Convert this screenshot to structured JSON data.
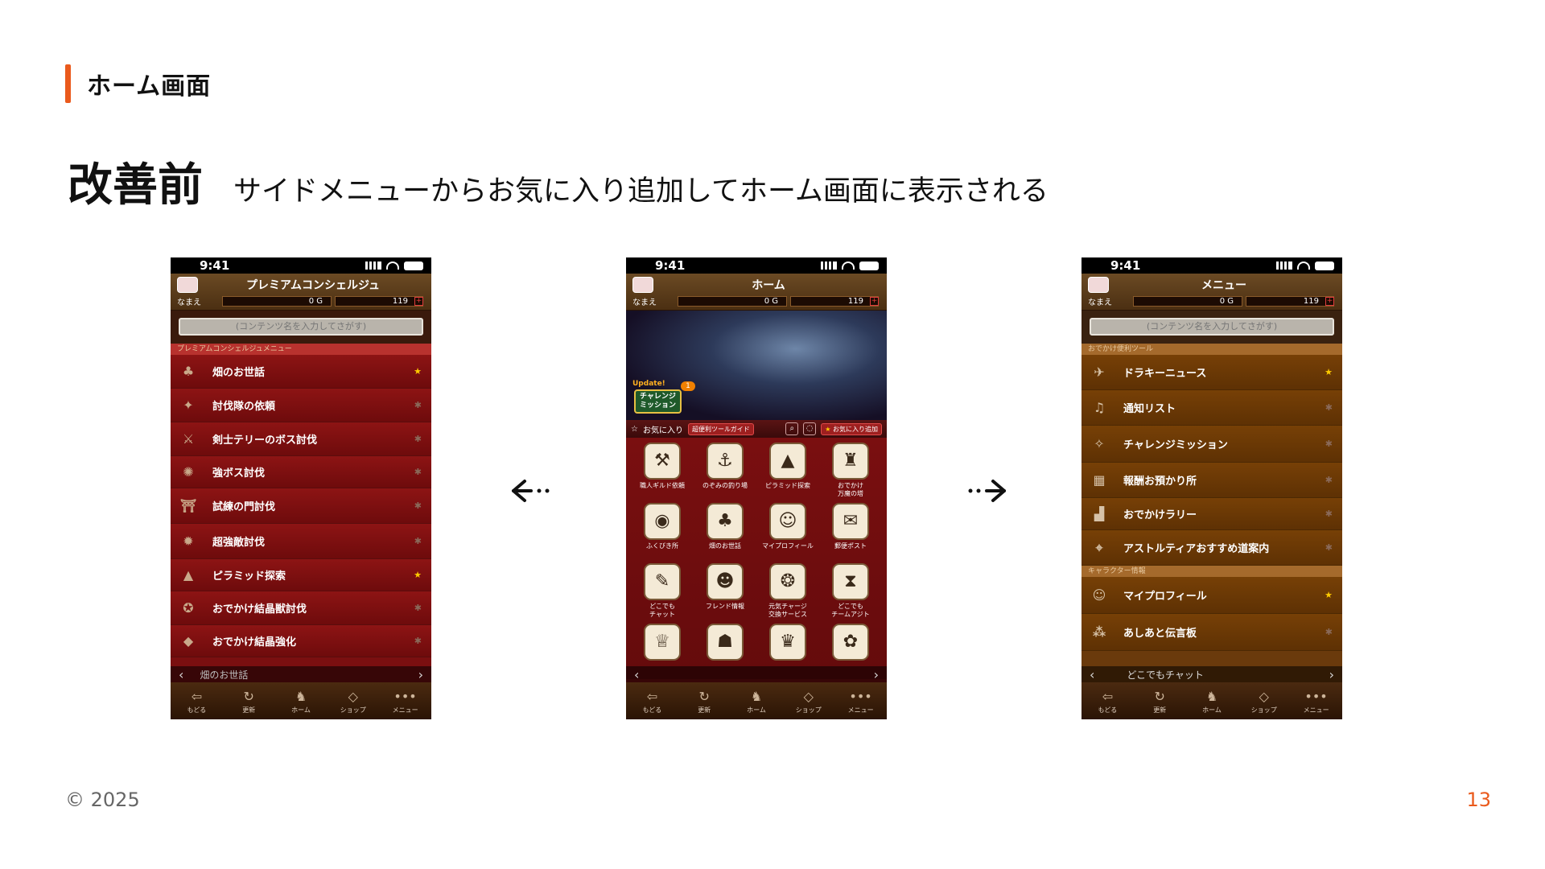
{
  "slide": {
    "section": "ホーム画面",
    "title": "改善前",
    "description": "サイドメニューからお気に入り追加してホーム画面に表示される",
    "copyright": "© 2025",
    "page_number": "13",
    "accent_color": "#ea5a1c"
  },
  "common": {
    "time": "9:41",
    "avatar_label": "なまえ",
    "gold": "0 G",
    "gems": "119",
    "plus": "+",
    "search_placeholder": "(コンテンツ名を入力してさがす)",
    "pager_left": "‹",
    "pager_right": "›",
    "tabs": [
      {
        "label": "もどる",
        "icon": "back-arrow-icon",
        "glyph": "⇦"
      },
      {
        "label": "更新",
        "icon": "refresh-icon",
        "glyph": "↻"
      },
      {
        "label": "ホーム",
        "icon": "dragon-home-icon",
        "glyph": "♞"
      },
      {
        "label": "ショップ",
        "icon": "slime-shop-icon",
        "glyph": "◇"
      },
      {
        "label": "メニュー",
        "icon": "more-dots-icon",
        "glyph": "•••"
      }
    ]
  },
  "left_screen": {
    "title": "プレミアムコンシェルジュ",
    "section": "プレミアムコンシェルジュメニュー",
    "items": [
      {
        "label": "畑のお世話",
        "glyph": "♣",
        "favorite": true
      },
      {
        "label": "討伐隊の依頼",
        "glyph": "✦",
        "favorite": false
      },
      {
        "label": "剣士テリーのボス討伐",
        "glyph": "⚔",
        "favorite": false
      },
      {
        "label": "強ボス討伐",
        "glyph": "✺",
        "favorite": false
      },
      {
        "label": "試練の門討伐",
        "glyph": "⛩",
        "favorite": false
      },
      {
        "label": "超強敵討伐",
        "glyph": "✹",
        "favorite": false
      },
      {
        "label": "ピラミッド探索",
        "glyph": "▲",
        "favorite": true
      },
      {
        "label": "おでかけ結晶獣討伐",
        "glyph": "✪",
        "favorite": false
      },
      {
        "label": "おでかけ結晶強化",
        "glyph": "◆",
        "favorite": false
      }
    ],
    "partial": "畑のお世話"
  },
  "center_screen": {
    "title": "ホーム",
    "update_tag": "Update!",
    "mission_label": "チャレンジ\nミッション",
    "mission_badge": "1",
    "fav_label": "お気に入り",
    "guide_chip": "超便利ツールガイド",
    "add_fav": "お気に入り追加",
    "grid": [
      {
        "label": "職人ギルド依頼",
        "glyph": "⚒"
      },
      {
        "label": "のぞみの釣り場",
        "glyph": "⚓"
      },
      {
        "label": "ピラミッド探索",
        "glyph": "▲"
      },
      {
        "label": "おでかけ\n万魔の塔",
        "glyph": "♜"
      },
      {
        "label": "ふくびき所",
        "glyph": "◉"
      },
      {
        "label": "畑のお世話",
        "glyph": "♣"
      },
      {
        "label": "マイプロフィール",
        "glyph": "☺"
      },
      {
        "label": "郵便ポスト",
        "glyph": "✉"
      },
      {
        "label": "どこでも\nチャット",
        "glyph": "✎"
      },
      {
        "label": "フレンド情報",
        "glyph": "☻"
      },
      {
        "label": "元気チャージ\n交換サービス",
        "glyph": "❂"
      },
      {
        "label": "どこでも\nチームアジト",
        "glyph": "⧗"
      },
      {
        "label": "",
        "glyph": "♕"
      },
      {
        "label": "",
        "glyph": "☗"
      },
      {
        "label": "",
        "glyph": "♛"
      },
      {
        "label": "",
        "glyph": "✿"
      }
    ]
  },
  "right_screen": {
    "title": "メニュー",
    "section1": "おでかけ便利ツール",
    "items1": [
      {
        "label": "ドラキーニュース",
        "glyph": "✈",
        "favorite": true
      },
      {
        "label": "通知リスト",
        "glyph": "♫",
        "favorite": false
      },
      {
        "label": "チャレンジミッション",
        "glyph": "✧",
        "favorite": false
      },
      {
        "label": "報酬お預かり所",
        "glyph": "▦",
        "favorite": false
      },
      {
        "label": "おでかけラリー",
        "glyph": "▟",
        "favorite": false
      },
      {
        "label": "アストルティアおすすめ道案内",
        "glyph": "⌖",
        "favorite": false
      }
    ],
    "section2": "キャラクター情報",
    "items2": [
      {
        "label": "マイプロフィール",
        "glyph": "☺",
        "favorite": true
      },
      {
        "label": "あしあと伝言板",
        "glyph": "⁂",
        "favorite": false
      }
    ],
    "partial": "どこでもチャット"
  }
}
